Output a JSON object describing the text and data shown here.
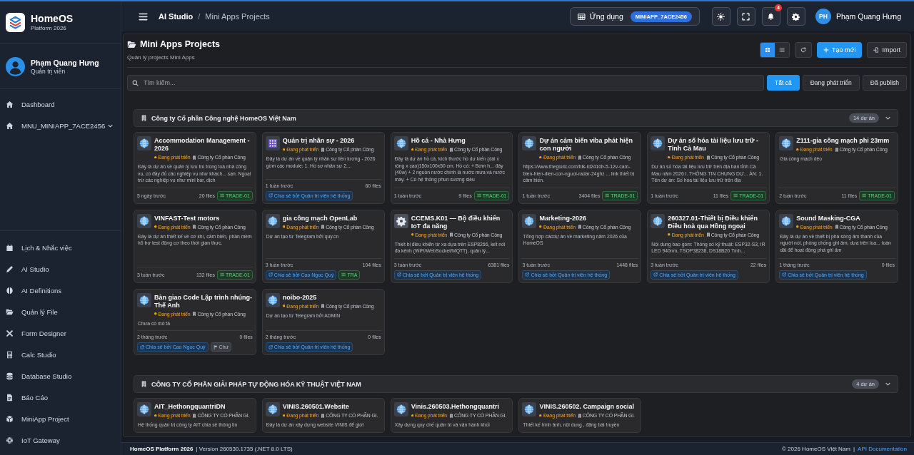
{
  "sidebar": {
    "brand": {
      "title": "HomeOS",
      "subtitle": "Platform 2026"
    },
    "user": {
      "name": "Phạm Quang Hưng",
      "role": "Quản trị viên"
    },
    "menu": [
      {
        "label": "Dashboard",
        "kind": "link"
      },
      {
        "label": "MNU_MINIAPP_7ACE2456",
        "kind": "group"
      }
    ],
    "apps": [
      {
        "label": "Lịch & Nhắc việc"
      },
      {
        "label": "AI Studio"
      },
      {
        "label": "AI Definitions"
      },
      {
        "label": "Quản lý File"
      },
      {
        "label": "Form Designer"
      },
      {
        "label": "Calc Studio"
      },
      {
        "label": "Database Studio"
      },
      {
        "label": "Báo Cáo"
      },
      {
        "label": "MiniApp Project"
      },
      {
        "label": "IoT Gateway"
      }
    ]
  },
  "topbar": {
    "breadcrumb": {
      "items": [
        "AI Studio",
        "Mini Apps Projects"
      ],
      "separator": "/"
    },
    "app": {
      "label": "Ứng dụng",
      "code": "MINIAPP_7ACE2456"
    },
    "notifications": "4",
    "user": {
      "initials": "PH",
      "name": "Phạm Quang Hưng"
    }
  },
  "page": {
    "title": "Mini Apps Projects",
    "subtitle": "Quản lý projects Mini Apps",
    "views": [
      {
        "kind": "grid",
        "selected": true
      },
      {
        "kind": "list",
        "selected": false
      }
    ],
    "actions": [
      {
        "label": "Tạo mới",
        "kind": "primary"
      },
      {
        "label": "Import",
        "kind": "secondary"
      }
    ],
    "search": {
      "placeholder": "Tìm kiếm..."
    },
    "filters": [
      {
        "label": "Tất cả",
        "selected": true
      },
      {
        "label": "Đang phát triển",
        "selected": false
      },
      {
        "label": "Đã publish",
        "selected": false
      }
    ]
  },
  "groups": [
    {
      "name": "Công ty Cổ phần Công nghệ HomeOS Việt Nam",
      "count": "14 dự án",
      "expanded": true,
      "projects": [
        {
          "title": "Accommodation Management - 2026",
          "status": "Đang phát triển",
          "company": "Công ty Cổ phần Công",
          "description": "Đây là dự án về quản lý lưu trú trong toà nhà công vụ, có đầy đủ các nghiệp vụ như khách... sạn. Ngoại trừ các nghiệp vụ như mini bar, dịch",
          "time": "5 ngày trước",
          "files": "20 files",
          "badges": [
            {
              "kind": "tag",
              "text": "TRADE-01"
            }
          ]
        },
        {
          "title": "Quản trị nhân sự - 2026",
          "status": "Đang phát triển",
          "company": "Công ty Cổ phần Công",
          "description": "Đây là dự án về quản lý nhân sự tiền lương - 2026 gồm các module: 1. Hồ sơ nhân sự 2....",
          "time": "1 tuần trước",
          "files": "60 files",
          "badges": [
            {
              "kind": "share",
              "text": "Chia sẻ bởi Quản trị viên hệ thống"
            }
          ]
        },
        {
          "title": "Hồ cá - Nhà Hưng",
          "status": "Đang phát triển",
          "company": "Công ty Cổ phần Công",
          "description": "Đây là dự án hồ cá, kích thước hồ dự kiến (dài x rộng x cao)150x100x50 cm. Hồ có: + Bơm h... đáy (40w) + 2 nguồn nước chính là nước mưa và nước máy. + Có hệ thống phun sương siêu",
          "time": "1 tuần trước",
          "files": "9 files",
          "badges": [
            {
              "kind": "tag",
              "text": "TRADE-01"
            }
          ]
        },
        {
          "title": "Dự án cảm biến viba phát hiện con người",
          "status": "Đang phát triển",
          "company": "Công ty Cổ phần Công",
          "description": "https://www.thegioiic.com/hlk-ld2410b-5-12v-cam-bien-hien-dien-con-nguoi-radar-24ghz ... link thiết bị cảm biến.",
          "time": "1 tuần trước",
          "files": "3404 files",
          "badges": [
            {
              "kind": "tag",
              "text": "TRADE-01"
            }
          ]
        },
        {
          "title": "Dự án số hóa tài liệu lưu trữ - Tỉnh Cà Mau",
          "status": "Đang phát triển",
          "company": "Công ty Cổ phần Công",
          "description": "Dự án số hóa tài liệu lưu trữ trên địa bàn tỉnh Cà Mau năm 2026 I. THÔNG TIN CHUNG DỰ... ÁN: 1. Tên dự án: Số hóa tài liệu lưu trữ trên địa",
          "time": "1 tuần trước",
          "files": "11 files",
          "badges": [
            {
              "kind": "tag",
              "text": "TRADE-01"
            }
          ]
        },
        {
          "title": "Z111-gia công mạch phi 23mm",
          "status": "Đang phát triển",
          "company": "Công ty Cổ phần Công",
          "description": "Gia công mạch dẻo",
          "time": "2 tuần trước",
          "files": "11 files",
          "badges": [
            {
              "kind": "tag",
              "text": "TRADE-01"
            }
          ]
        },
        {
          "title": "VINFAST-Test motors",
          "status": "Đang phát triển",
          "company": "Công ty Cổ phần Công",
          "description": "Đây là dự án thiết kế về cơ khí, cảm biến, phần mềm hỗ trợ test động cơ theo thời gian thực.",
          "time": "3 tuần trước",
          "files": "132 files",
          "badges": [
            {
              "kind": "tag",
              "text": "TRADE-01"
            }
          ]
        },
        {
          "title": "gia công mạch OpenLab",
          "status": "Đang phát triển",
          "company": "Công ty Cổ phần Công",
          "description": "Dự án tạo từ Telegram bởi quy.cn",
          "time": "3 tuần trước",
          "files": "104 files",
          "badges": [
            {
              "kind": "share",
              "text": "Chia sẻ bởi Cao Ngọc Quý"
            },
            {
              "kind": "tag",
              "text": "TRA"
            }
          ]
        },
        {
          "title": "CCEMS.K01 — Bộ điều khiển IoT đa năng",
          "status": "Đang phát triển",
          "company": "Công ty Cổ phần Công",
          "description": "Thiết bị điều khiển từ xa dựa trên ESP8266, kết nối đa kênh (WiFi/WebSocket/MQTT), quản lý...",
          "time": "3 tuần trước",
          "files": "6381 files",
          "badges": [
            {
              "kind": "share",
              "text": "Chia sẻ bởi Quản trị viên hệ thống"
            }
          ]
        },
        {
          "title": "Marketing-2026",
          "status": "Đang phát triển",
          "company": "Công ty Cổ phần Công",
          "description": "Tổng hợp cácdự án về marketing năm 2026 của HomeOS",
          "time": "3 tuần trước",
          "files": "1448 files",
          "badges": [
            {
              "kind": "share",
              "text": "Chia sẻ bởi Quản trị viên hệ thống"
            }
          ]
        },
        {
          "title": "260327.01-Thiết bị Điều khiển Điều hoà qua Hồng ngoại",
          "status": "Đang phát triển",
          "company": "Công ty Cổ phần Công",
          "description": "Nội dung bao gồm: Thông số kỹ thuật: ESP32-S3, IR LED 940nm, TSOP38238, DS18B20 Tính...",
          "time": "3 tuần trước",
          "files": "22 files",
          "badges": [
            {
              "kind": "share",
              "text": "Chia sẻ bởi Quản trị viên hệ thống"
            }
          ]
        },
        {
          "title": "Sound Masking-CGA",
          "status": "Đang phát triển",
          "company": "Công ty Cổ phần Công",
          "description": "Đây là dự án về thiết bị phá sóng âm thanh của người nói, phòng chống ghi âm, dựa trên loa... toàn dải để hoạt động phá ghi âm",
          "time": "1 tháng trước",
          "files": "0 files",
          "badges": [
            {
              "kind": "share",
              "text": "Chia sẻ bởi Quản trị viên hệ thống"
            }
          ]
        },
        {
          "title": "Bàn giao Code Lập trình nhúng- Thế Anh",
          "status": "Đang phát triển",
          "company": "Công ty Cổ phần Công",
          "description": "Chưa có mô tả",
          "time": "2 tháng trước",
          "files": "0 files",
          "badges": [
            {
              "kind": "share",
              "text": "Chia sẻ bởi Cao Ngọc Quý"
            },
            {
              "kind": "flag",
              "text": "Chư"
            }
          ]
        },
        {
          "title": "noibo-2025",
          "status": "Đang phát triển",
          "company": "Công ty Cổ phần Công",
          "description": "Dự án tạo từ Telegram bởi ADMIN",
          "time": "2 tháng trước",
          "files": "0 files",
          "badges": [
            {
              "kind": "share",
              "text": "Chia sẻ bởi Quản trị viên hệ thống"
            }
          ]
        }
      ]
    },
    {
      "name": "CÔNG TY CỔ PHẦN GIẢI PHÁP TỰ ĐỘNG HÓA KỸ THUẬT VIỆT NAM",
      "count": "4 dự án",
      "expanded": true,
      "projects": [
        {
          "title": "AIT_HethongquantriDN",
          "status": "Đang phát triển",
          "company": "CÔNG TY CỔ PHẦN GI.",
          "description": "Hệ thống quản trị công ty AIT chia sẻ thông tin"
        },
        {
          "title": "VINIS.260501.Website",
          "status": "Đang phát triển",
          "company": "CÔNG TY CỔ PHẦN GI.",
          "description": "Đây là dự án xây dựng website VINIS để giới"
        },
        {
          "title": "Vinis.260503.Hethongquantri",
          "status": "Đang phát triển",
          "company": "CÔNG TY CỔ PHẦN GI.",
          "description": "Xây dựng quy chế quản trị và vận hành khối"
        },
        {
          "title": "VINIS.260502. Campaign social",
          "status": "Đang phát triển",
          "company": "CÔNG TY CỔ PHẦN GI.",
          "description": "Thiết kế hình ảnh, nội dung , đăng bài truyền"
        }
      ]
    }
  ],
  "footer": {
    "brand": "HomeOS Platform 2026",
    "version": "| Version 260530.1735 (.NET 8.0 LTS)",
    "copyright": "© 2026 HomeOS Việt Nam",
    "separator": "|",
    "link": "API Documentation"
  }
}
